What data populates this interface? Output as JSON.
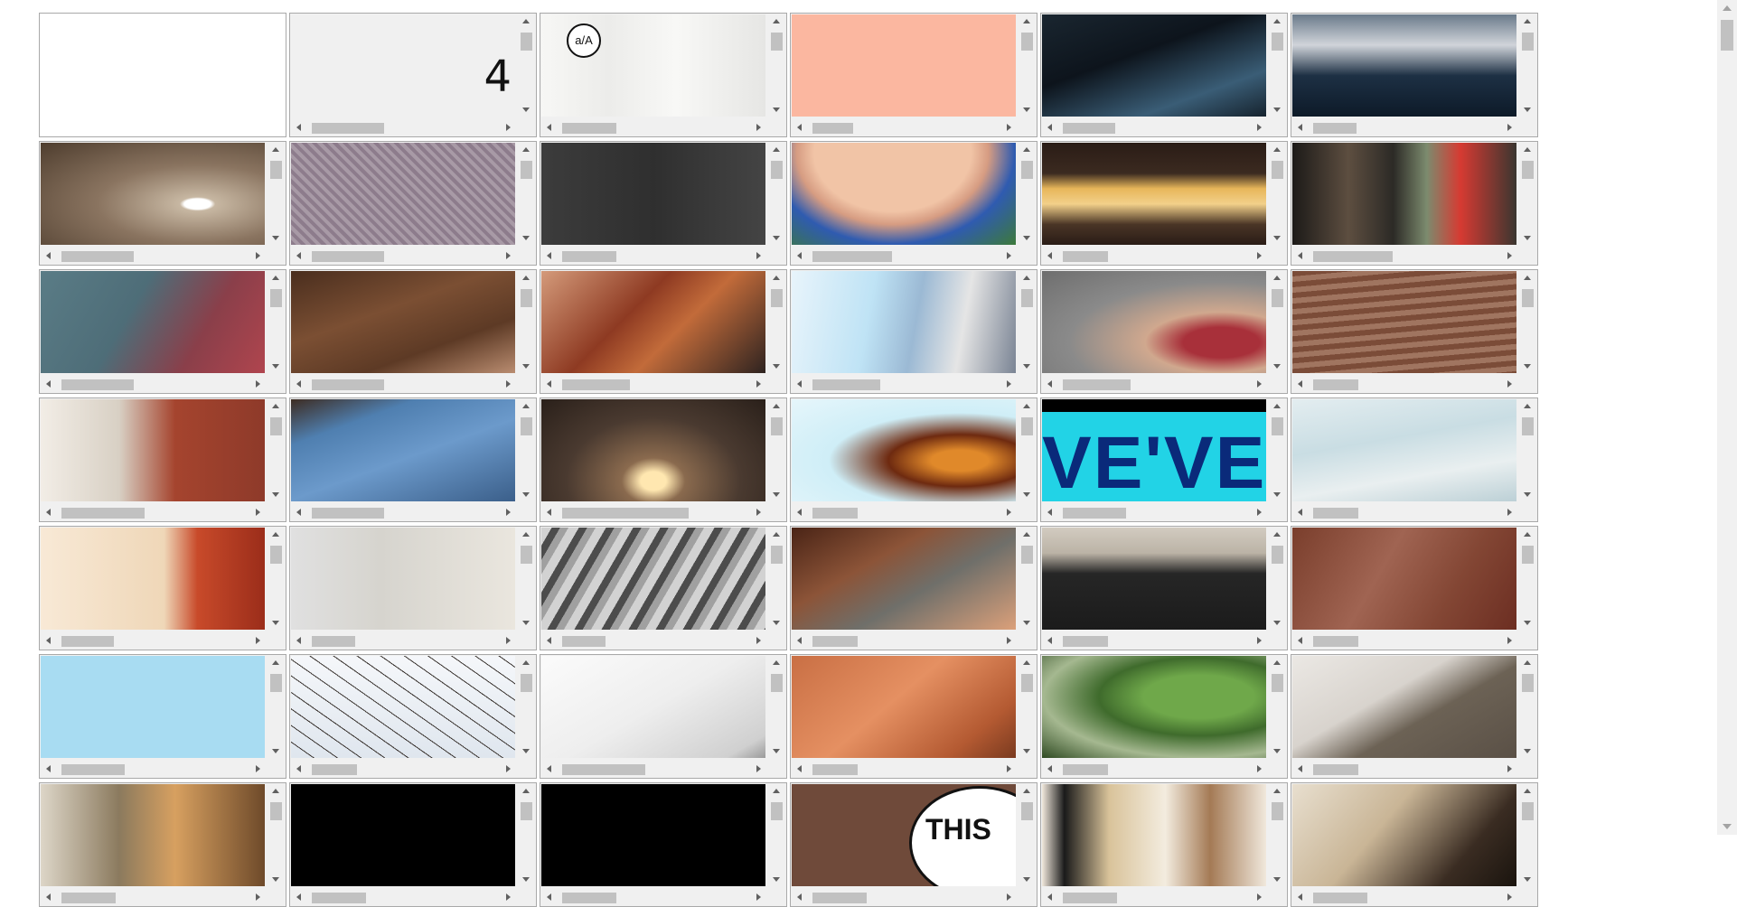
{
  "frames": [
    {
      "kind": "plain"
    },
    {
      "kind": "text",
      "text": "4",
      "bg": "#f0f0f0"
    },
    {
      "kind": "whiteboard",
      "logo": "a/A"
    },
    {
      "kind": "solid",
      "bg": "#fbb7a0"
    },
    {
      "kind": "scene",
      "bg": "linear-gradient(160deg,#1a2630 0%,#0d141c 40%,#3a5d76 75%,#16232e 100%)"
    },
    {
      "kind": "scene",
      "bg": "linear-gradient(180deg,#6a7a8a 0%,#d0d4da 30%,#1d3044 60%,#0d1a28 100%)"
    },
    {
      "kind": "scene",
      "bg": "radial-gradient(ellipse at 70% 60%,#ffffff 0 6%,#c7b7a2 8%,#8a7460 45%,#4e3d2e 100%)"
    },
    {
      "kind": "scene",
      "bg": "repeating-linear-gradient(45deg,#8d7c8c 0 4px,#a89aa6 4px 8px),#8d7c8c"
    },
    {
      "kind": "scene",
      "bg": "linear-gradient(90deg,#3c3c3c 0%,#2f2f2f 50%,#444444 100%)"
    },
    {
      "kind": "scene",
      "bg": "radial-gradient(ellipse at 45% 10%,#f1c4a6 0 45%,#d69c82 55%,#2f5bb0 70%,#3d7a3a 100%)"
    },
    {
      "kind": "scene",
      "bg": "linear-gradient(180deg,#2a1c16 0%,#3b2a20 30%,#e7b65a 45%,#f2d08a 60%,#4a3526 80%,#2a1c16 100%)"
    },
    {
      "kind": "scene",
      "bg": "linear-gradient(90deg,#1c1a18 0%,#5d4e40 25%,#2c2a26 45%,#7c8b6e 60%,#d63a32 75%,#3a3630 100%)"
    },
    {
      "kind": "scene",
      "bg": "linear-gradient(120deg,#5a7c86 0%,#4e6d78 40%,#8a3f4a 70%,#b0454e 100%)"
    },
    {
      "kind": "scene",
      "bg": "linear-gradient(160deg,#4a2e1e 0%,#7b4f33 40%,#5d3a25 70%,#b98c70 100%)"
    },
    {
      "kind": "scene",
      "bg": "linear-gradient(135deg,#d49a7a 0%,#8e3a22 40%,#c26b3a 60%,#2e2320 100%)"
    },
    {
      "kind": "scene",
      "bg": "linear-gradient(100deg,#e8f4fb 0%,#bfe3f5 35%,#9bb9d4 55%,#e5e5e5 75%,#7a8494 100%)"
    },
    {
      "kind": "scene",
      "bg": "radial-gradient(ellipse at 80% 70%,#a8303a 0 15%,#d0a88e 30%,#8a8a8a 60%,#6e6e6e 100%)"
    },
    {
      "kind": "scene",
      "bg": "repeating-linear-gradient(175deg,#7b4c38 0 6px,#a07560 6px 12px),#7b4c38"
    },
    {
      "kind": "scene",
      "bg": "linear-gradient(90deg,#f2ede6 0%,#d8d0c4 35%,#a5442e 60%,#8e3a2a 100%)"
    },
    {
      "kind": "scene",
      "bg": "linear-gradient(160deg,#3d2c22 0%,#4f7fb0 25%,#6c9acb 55%,#3b5f8a 100%)"
    },
    {
      "kind": "scene",
      "bg": "radial-gradient(ellipse at 50% 80%,#ffe7b0 0 8%,#8a6a4e 20%,#4a3a30 55%,#2a201a 100%)"
    },
    {
      "kind": "scene",
      "bg": "radial-gradient(ellipse at 75% 60%,#e0892a 0 12%,#6e2a10 30%,#cfeef7 55%,#e6f6fb 100%)"
    },
    {
      "kind": "bigtext",
      "text": "VE'VE",
      "bg": "#22d3e6"
    },
    {
      "kind": "scene",
      "bg": "linear-gradient(170deg,#e3edf0 0%,#c9dde3 40%,#e9eff0 70%,#bcd0d6 100%)"
    },
    {
      "kind": "scene",
      "bg": "linear-gradient(90deg,#f8e9d6 0%,#efd7b8 55%,#c84a2a 70%,#9b2d1a 100%)"
    },
    {
      "kind": "scene",
      "bg": "linear-gradient(90deg,#e0e0e0 0%,#d6d4ce 40%,#eae6de 100%)"
    },
    {
      "kind": "scene",
      "bg": "repeating-linear-gradient(120deg,#d2d2d2 0 10px,#4c4c4c 10px 18px,#a0a0a0 18px 26px)"
    },
    {
      "kind": "scene",
      "bg": "linear-gradient(150deg,#4a2416 0%,#8c5438 35%,#6f6f6a 60%,#dba07a 100%)"
    },
    {
      "kind": "scene",
      "bg": "linear-gradient(180deg,#d2cbc0 0%,#bbb3a6 25%,#262626 45%,#1b1b1b 100%)"
    },
    {
      "kind": "scene",
      "bg": "linear-gradient(120deg,#7a3e2c 0%,#a06452 40%,#834634 70%,#6c2e22 100%)"
    },
    {
      "kind": "solid",
      "bg": "#a8dcf2"
    },
    {
      "kind": "scene",
      "bg": "repeating-linear-gradient(35deg,transparent 0 14px,#3a3430 14px 15px),linear-gradient(180deg,#f5f7fa,#dfe6ee)"
    },
    {
      "kind": "scene",
      "bg": "linear-gradient(150deg,#fbfbfb 0%,#eeeeee 50%,#d0d0d0 90%,#9a9a9a 100%)"
    },
    {
      "kind": "scene",
      "bg": "linear-gradient(140deg,#c96f44 0%,#e59062 45%,#b45a32 80%,#7a3a1f 100%)"
    },
    {
      "kind": "scene",
      "bg": "radial-gradient(ellipse at 70% 40%,#6fa84a 0 25%,#3f6b2c 45%,#a5b890 70%,#2f4a22 100%)"
    },
    {
      "kind": "scene",
      "bg": "linear-gradient(150deg,#ebe8e4 0%,#d8d3cd 40%,#6c6255 60%,#5a5046 100%)"
    },
    {
      "kind": "scene",
      "bg": "linear-gradient(90deg,#ddd6c8 0%,#8b7a5e 35%,#d7a060 60%,#6e4a2a 100%)"
    },
    {
      "kind": "solid",
      "bg": "#000000"
    },
    {
      "kind": "solid",
      "bg": "#000000"
    },
    {
      "kind": "comic",
      "text": "THIS",
      "bg": "#6f4a3a"
    },
    {
      "kind": "scene",
      "bg": "linear-gradient(90deg,#f1e8dc 0%,#1a1a1a 10%,#d9c39a 30%,#f3ecdf 55%,#a47a55 75%,#f0e8dc 100%)"
    },
    {
      "kind": "scene",
      "bg": "linear-gradient(130deg,#e8dfcf 0%,#c9b596 40%,#3a2c22 75%,#1a140e 100%)"
    }
  ]
}
